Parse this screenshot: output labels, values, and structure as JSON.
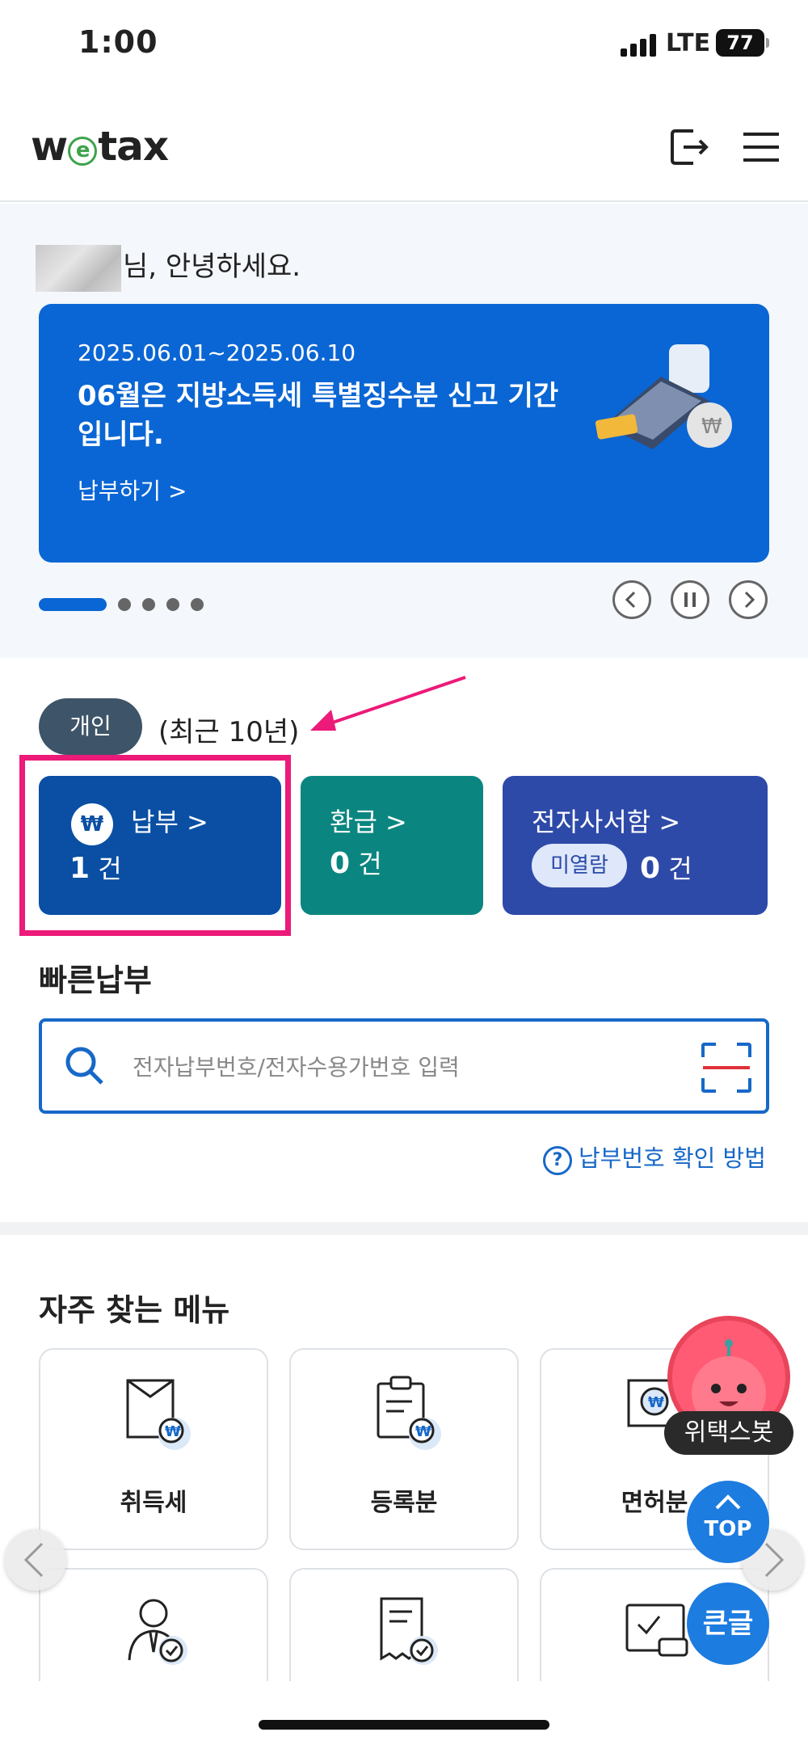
{
  "status_bar": {
    "time": "1:00",
    "network": "LTE",
    "battery": "77"
  },
  "header": {
    "logo_left": "w",
    "logo_mid": "e",
    "logo_right": "tax"
  },
  "greeting": {
    "suffix": "님, 안녕하세요."
  },
  "banner": {
    "date_range": "2025.06.01~2025.06.10",
    "title": "06월은 지방소득세 특별징수분 신고 기간입니다.",
    "link_label": "납부하기 >"
  },
  "carousel": {
    "slide_count": 5,
    "active_index": 0
  },
  "category": {
    "chip": "개인",
    "subtitle": "(최근 10년)"
  },
  "tiles": {
    "payment": {
      "label": "납부 >",
      "count": "1",
      "unit": "건",
      "icon_text": "₩"
    },
    "refund": {
      "label": "환급 >",
      "count": "0",
      "unit": "건"
    },
    "mailbox": {
      "label": "전자사서함 >",
      "badge": "미열람",
      "count": "0",
      "unit": "건"
    }
  },
  "quick_pay": {
    "title": "빠른납부",
    "placeholder": "전자납부번호/전자수용가번호 입력",
    "help_icon": "?",
    "help_label": "납부번호 확인 방법"
  },
  "frequent_menu": {
    "title": "자주 찾는 메뉴",
    "items": [
      {
        "label": "취득세",
        "icon": "document-won-icon"
      },
      {
        "label": "등록분",
        "icon": "clipboard-won-icon"
      },
      {
        "label": "면허분",
        "icon": "certificate-won-icon"
      },
      {
        "label": "",
        "icon": "person-check-icon"
      },
      {
        "label": "",
        "icon": "receipt-check-icon"
      },
      {
        "label": "",
        "icon": "card-check-icon"
      }
    ]
  },
  "floating": {
    "chatbot_label": "위택스봇",
    "top_label": "TOP",
    "large_text_label": "큰글"
  },
  "colors": {
    "primary": "#0a66d4",
    "payment_tile": "#0a4fa3",
    "refund_tile": "#0b8580",
    "mailbox_tile": "#2e4aa8",
    "highlight": "#ec1a78",
    "chip": "#3e5468"
  }
}
